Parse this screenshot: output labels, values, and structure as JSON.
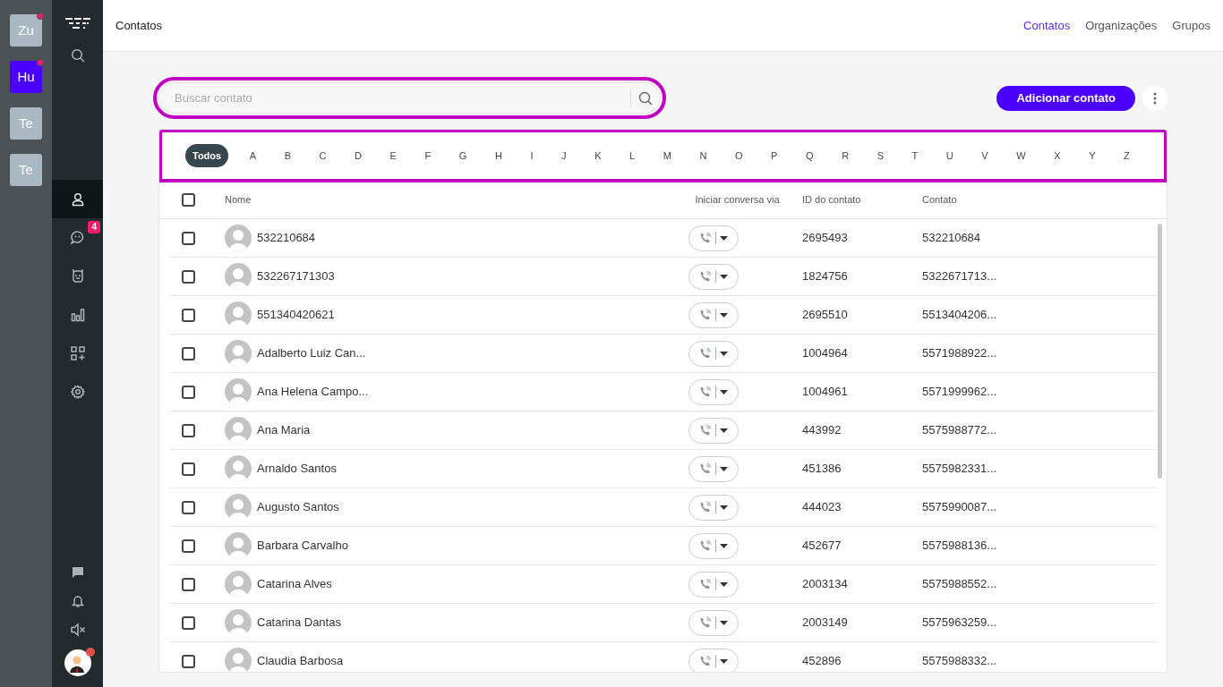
{
  "workspaces": [
    {
      "label": "Zu",
      "selected": false,
      "unread": true
    },
    {
      "label": "Hu",
      "selected": true,
      "unread": true
    },
    {
      "label": "Te",
      "selected": false,
      "unread": false
    },
    {
      "label": "Te",
      "selected": false,
      "unread": false
    }
  ],
  "nav": {
    "items": [
      {
        "selected": true
      },
      {
        "selected": false,
        "badge": "4"
      },
      {
        "selected": false
      },
      {
        "selected": false
      },
      {
        "selected": false
      },
      {
        "selected": false
      }
    ],
    "user": {
      "notification": true
    }
  },
  "header": {
    "title": "Contatos",
    "links": [
      {
        "label": "Contatos",
        "selected": true
      },
      {
        "label": "Organizações",
        "selected": false
      },
      {
        "label": "Grupos",
        "selected": false
      }
    ]
  },
  "search": {
    "placeholder": "Buscar contato",
    "highlighted": true
  },
  "add_button": "Adicionar contato",
  "letter_filter": {
    "highlighted": true,
    "letters": [
      {
        "label": "Todos",
        "selected": true
      },
      {
        "label": "A",
        "selected": false
      },
      {
        "label": "B",
        "selected": false
      },
      {
        "label": "C",
        "selected": false
      },
      {
        "label": "D",
        "selected": false
      },
      {
        "label": "E",
        "selected": false
      },
      {
        "label": "F",
        "selected": false
      },
      {
        "label": "G",
        "selected": false
      },
      {
        "label": "H",
        "selected": false
      },
      {
        "label": "I",
        "selected": false
      },
      {
        "label": "J",
        "selected": false
      },
      {
        "label": "K",
        "selected": false
      },
      {
        "label": "L",
        "selected": false
      },
      {
        "label": "M",
        "selected": false
      },
      {
        "label": "N",
        "selected": false
      },
      {
        "label": "O",
        "selected": false
      },
      {
        "label": "P",
        "selected": false
      },
      {
        "label": "Q",
        "selected": false
      },
      {
        "label": "R",
        "selected": false
      },
      {
        "label": "S",
        "selected": false
      },
      {
        "label": "T",
        "selected": false
      },
      {
        "label": "U",
        "selected": false
      },
      {
        "label": "V",
        "selected": false
      },
      {
        "label": "W",
        "selected": false
      },
      {
        "label": "X",
        "selected": false
      },
      {
        "label": "Y",
        "selected": false
      },
      {
        "label": "Z",
        "selected": false
      }
    ]
  },
  "table": {
    "all_checked": false,
    "columns": [
      "Nome",
      "Iniciar conversa via",
      "ID do contato",
      "Contato"
    ],
    "rows": [
      {
        "checked": false,
        "name": "532210684",
        "id": "2695493",
        "contact": "532210684"
      },
      {
        "checked": false,
        "name": "532267171303",
        "id": "1824756",
        "contact": "5322671713..."
      },
      {
        "checked": false,
        "name": "551340420621",
        "id": "2695510",
        "contact": "5513404206..."
      },
      {
        "checked": false,
        "name": "Adalberto Luiz Can...",
        "id": "1004964",
        "contact": "5571988922..."
      },
      {
        "checked": false,
        "name": "Ana Helena Campo...",
        "id": "1004961",
        "contact": "5571999962..."
      },
      {
        "checked": false,
        "name": "Ana Maria",
        "id": "443992",
        "contact": "5575988772..."
      },
      {
        "checked": false,
        "name": "Arnaldo Santos",
        "id": "451386",
        "contact": "5575982331..."
      },
      {
        "checked": false,
        "name": "Augusto Santos",
        "id": "444023",
        "contact": "5575990087..."
      },
      {
        "checked": false,
        "name": "Barbara Carvalho",
        "id": "452677",
        "contact": "5575988136..."
      },
      {
        "checked": false,
        "name": "Catarina Alves",
        "id": "2003134",
        "contact": "5575988552..."
      },
      {
        "checked": false,
        "name": "Catarina Dantas",
        "id": "2003149",
        "contact": "5575963259..."
      },
      {
        "checked": false,
        "name": "Claudia Barbosa",
        "id": "452896",
        "contact": "5575988332..."
      }
    ]
  }
}
